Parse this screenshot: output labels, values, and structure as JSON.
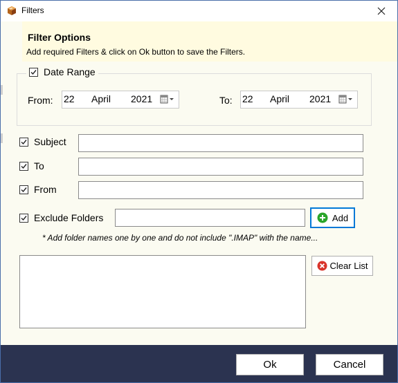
{
  "window": {
    "title": "Filters"
  },
  "header": {
    "title": "Filter Options",
    "subtitle": "Add required Filters & click on Ok button to save the Filters."
  },
  "date_range": {
    "label": "Date Range",
    "checked": true,
    "from": {
      "label": "From:",
      "day": "22",
      "month": "April",
      "year": "2021"
    },
    "to": {
      "label": "To:",
      "day": "22",
      "month": "April",
      "year": "2021"
    }
  },
  "filters": {
    "subject": {
      "label": "Subject",
      "checked": true,
      "value": ""
    },
    "to": {
      "label": "To",
      "checked": true,
      "value": ""
    },
    "from": {
      "label": "From",
      "checked": true,
      "value": ""
    },
    "exclude_folders": {
      "label": "Exclude Folders",
      "checked": true,
      "value": ""
    }
  },
  "buttons": {
    "add": "Add",
    "clear_list": "Clear List",
    "ok": "Ok",
    "cancel": "Cancel"
  },
  "note": "* Add folder names one by one and do not include \".IMAP\" with the name...",
  "icons": {
    "app": "app-box-icon",
    "close": "close-icon",
    "calendar": "calendar-dropdown-icon",
    "add": "plus-circle-icon",
    "clear": "x-circle-icon"
  },
  "colors": {
    "footer": "#2b3350",
    "header_panel": "#fffbe0",
    "content": "#fbfbf1",
    "focus": "#0078d7",
    "add_icon": "#2aa52a",
    "clear_icon": "#d9342b"
  }
}
